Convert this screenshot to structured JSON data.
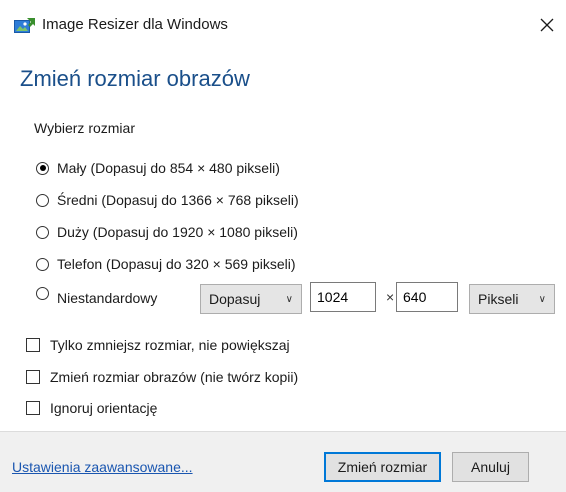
{
  "window": {
    "title": "Image Resizer dla Windows",
    "icon": "image-resizer-icon",
    "close_icon": "close-icon"
  },
  "heading": "Zmień rozmiar obrazów",
  "section_label": "Wybierz rozmiar",
  "sizes": [
    {
      "label": "Mały (Dopasuj do 854 × 480 pikseli)",
      "selected": true
    },
    {
      "label": "Średni (Dopasuj do 1366 × 768 pikseli)",
      "selected": false
    },
    {
      "label": "Duży (Dopasuj do 1920 × 1080 pikseli)",
      "selected": false
    },
    {
      "label": "Telefon (Dopasuj do 320 × 569 pikseli)",
      "selected": false
    }
  ],
  "custom": {
    "label": "Niestandardowy",
    "fit_mode": "Dopasuj",
    "width": "1024",
    "times": "×",
    "height": "640",
    "unit": "Pikseli",
    "selected": false
  },
  "options": [
    {
      "label": "Tylko zmniejsz rozmiar, nie powiększaj",
      "checked": false
    },
    {
      "label": "Zmień rozmiar obrazów (nie twórz kopii)",
      "checked": false
    },
    {
      "label": "Ignoruj orientację",
      "checked": false
    }
  ],
  "footer": {
    "advanced_link": "Ustawienia zaawansowane...",
    "resize_button": "Zmień rozmiar",
    "cancel_button": "Anuluj"
  },
  "colors": {
    "accent": "#0078d7",
    "heading": "#1a4f8a",
    "link": "#1a56b0"
  }
}
